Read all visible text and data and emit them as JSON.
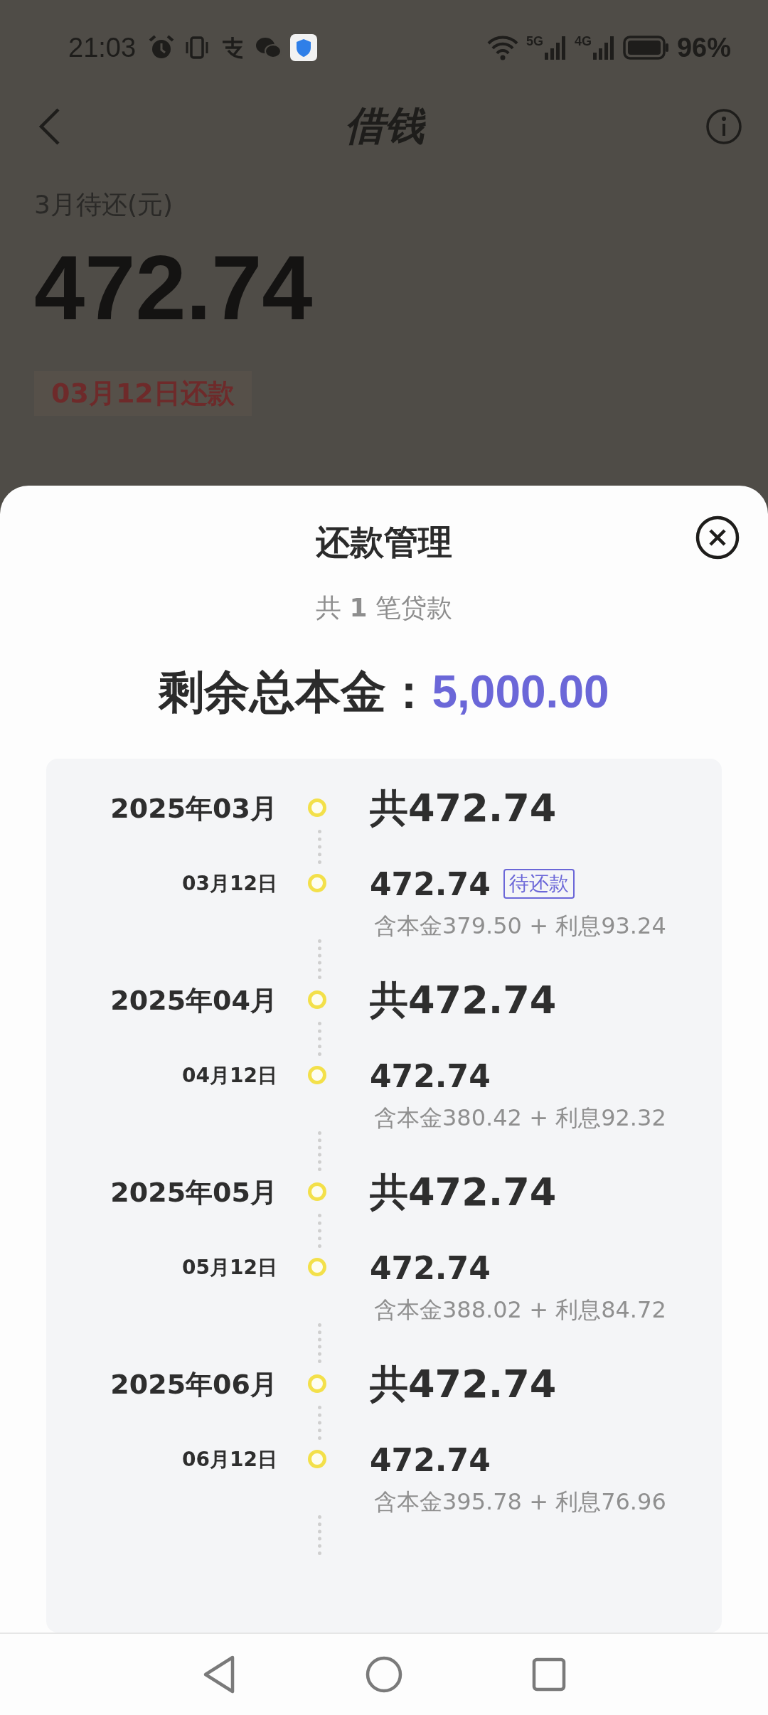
{
  "status_bar": {
    "time": "21:03",
    "networks": [
      "5G",
      "4G"
    ],
    "battery": "96%"
  },
  "header": {
    "title": "借钱"
  },
  "summary": {
    "label": "3月待还(元)",
    "amount": "472.74",
    "due_tag": "03月12日还款"
  },
  "sheet": {
    "title": "还款管理",
    "count": "共 **1** 笔贷款",
    "total_label": "剩余总本金：",
    "total_value": "5,000.00",
    "months": [
      {
        "month": "2025年03月",
        "total": "共472.74",
        "payments": [
          {
            "date": "03月12日",
            "amount": "472.74",
            "status": "待还款",
            "breakdown": "含本金379.50 + 利息93.24"
          }
        ]
      },
      {
        "month": "2025年04月",
        "total": "共472.74",
        "payments": [
          {
            "date": "04月12日",
            "amount": "472.74",
            "breakdown": "含本金380.42 + 利息92.32"
          }
        ]
      },
      {
        "month": "2025年05月",
        "total": "共472.74",
        "payments": [
          {
            "date": "05月12日",
            "amount": "472.74",
            "breakdown": "含本金388.02 + 利息84.72"
          }
        ]
      },
      {
        "month": "2025年06月",
        "total": "共472.74",
        "payments": [
          {
            "date": "06月12日",
            "amount": "472.74",
            "breakdown": "含本金395.78 + 利息76.96"
          }
        ]
      }
    ]
  }
}
